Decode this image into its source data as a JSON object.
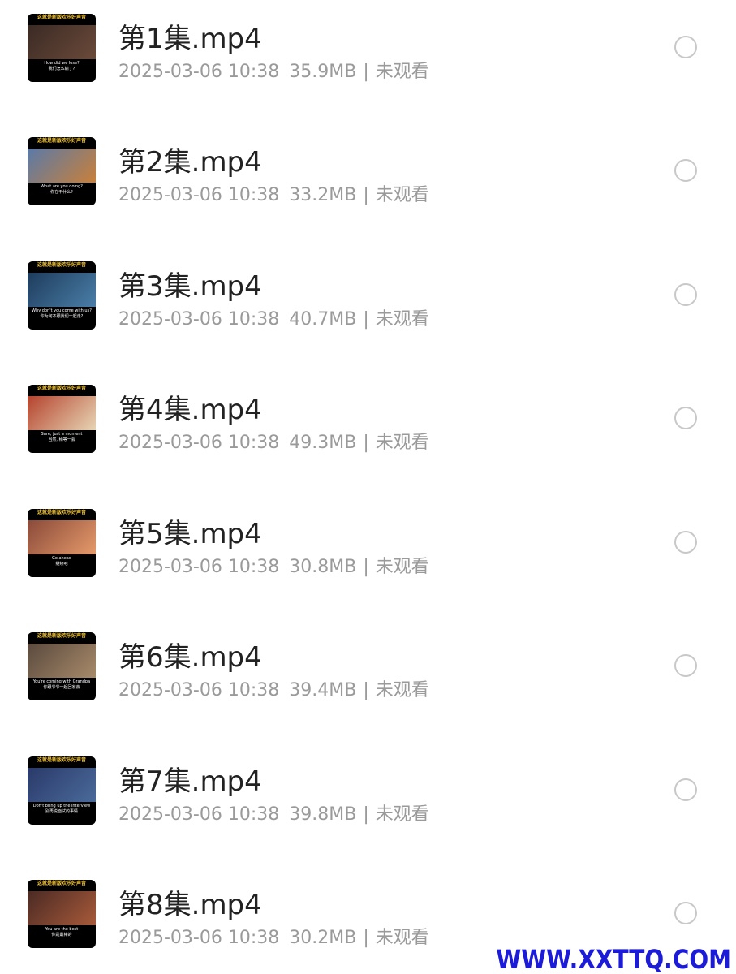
{
  "files": [
    {
      "name": "第1集.mp4",
      "date": "2025-03-06 10:38",
      "size": "35.9MB",
      "status": "未观看",
      "thumb": {
        "banner": "这就是新版欢乐好声音",
        "sub1": "How did we lose?",
        "sub2": "我们怎么输了?",
        "scene_colors": [
          "#3a2a24",
          "#6b4a3a"
        ]
      }
    },
    {
      "name": "第2集.mp4",
      "date": "2025-03-06 10:38",
      "size": "33.2MB",
      "status": "未观看",
      "thumb": {
        "banner": "这就是新版欢乐好声音",
        "sub1": "What are you doing?",
        "sub2": "你在干什么?",
        "scene_colors": [
          "#5a7aa8",
          "#c9803a"
        ]
      }
    },
    {
      "name": "第3集.mp4",
      "date": "2025-03-06 10:38",
      "size": "40.7MB",
      "status": "未观看",
      "thumb": {
        "banner": "这就是新版欢乐好声音",
        "sub1": "Why don't you come with us?",
        "sub2": "你为何不跟我们一起走?",
        "scene_colors": [
          "#1e3c5c",
          "#4a7ea8"
        ]
      }
    },
    {
      "name": "第4集.mp4",
      "date": "2025-03-06 10:38",
      "size": "49.3MB",
      "status": "未观看",
      "thumb": {
        "banner": "这就是新版欢乐好声音",
        "sub1": "Sure, just a moment",
        "sub2": "当然, 稍等一会",
        "scene_colors": [
          "#b5432e",
          "#e7d5b4"
        ]
      }
    },
    {
      "name": "第5集.mp4",
      "date": "2025-03-06 10:38",
      "size": "30.8MB",
      "status": "未观看",
      "thumb": {
        "banner": "这就是新版欢乐好声音",
        "sub1": "Go ahead",
        "sub2": "继续吧",
        "scene_colors": [
          "#8a4a3a",
          "#e59a6a"
        ]
      }
    },
    {
      "name": "第6集.mp4",
      "date": "2025-03-06 10:38",
      "size": "39.4MB",
      "status": "未观看",
      "thumb": {
        "banner": "这就是新版欢乐好声音",
        "sub1": "You're coming with Grandpa",
        "sub2": "你跟爷爷一起回家去",
        "scene_colors": [
          "#5a4a3e",
          "#a88a6a"
        ]
      }
    },
    {
      "name": "第7集.mp4",
      "date": "2025-03-06 10:38",
      "size": "39.8MB",
      "status": "未观看",
      "thumb": {
        "banner": "这就是新版欢乐好声音",
        "sub1": "Don't bring up the interview",
        "sub2": "别再说面试的事情",
        "scene_colors": [
          "#2a3a6a",
          "#4a6a9a"
        ]
      }
    },
    {
      "name": "第8集.mp4",
      "date": "2025-03-06 10:38",
      "size": "30.2MB",
      "status": "未观看",
      "thumb": {
        "banner": "这就是新版欢乐好声音",
        "sub1": "You are the best",
        "sub2": "你是最棒的",
        "scene_colors": [
          "#4a2a24",
          "#a85a3a"
        ]
      }
    }
  ],
  "watermark": "WWW.XXTTQ.COM",
  "colors": {
    "title": "#222222",
    "meta": "#9a9a9a",
    "radio_border": "#c8c8c8",
    "watermark": "#1c1cd8"
  }
}
